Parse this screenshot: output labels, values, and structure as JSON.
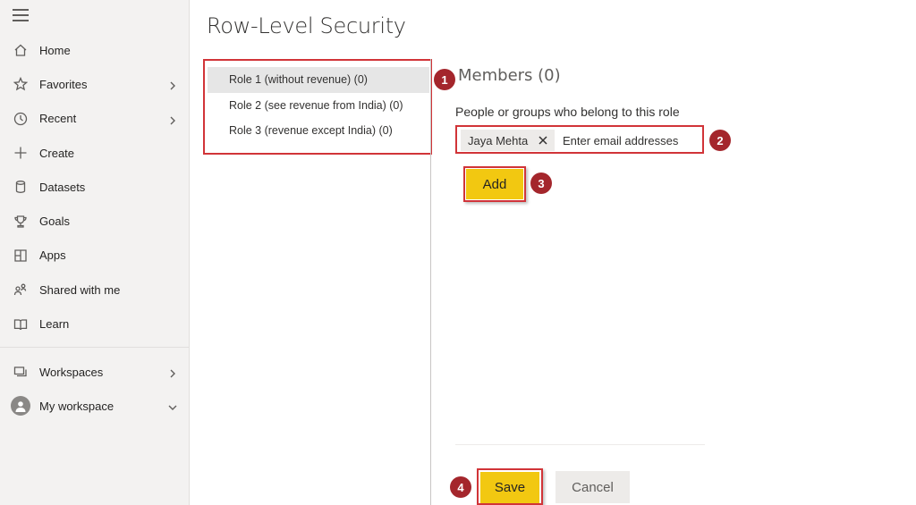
{
  "sidebar": {
    "items": [
      {
        "label": "Home",
        "icon": "home-icon"
      },
      {
        "label": "Favorites",
        "icon": "star-icon"
      },
      {
        "label": "Recent",
        "icon": "clock-icon"
      },
      {
        "label": "Create",
        "icon": "plus-icon"
      },
      {
        "label": "Datasets",
        "icon": "database-icon"
      },
      {
        "label": "Goals",
        "icon": "trophy-icon"
      },
      {
        "label": "Apps",
        "icon": "apps-icon"
      },
      {
        "label": "Shared with me",
        "icon": "shared-icon"
      },
      {
        "label": "Learn",
        "icon": "book-icon"
      }
    ],
    "bottom_items": [
      {
        "label": "Workspaces",
        "icon": "workspaces-icon"
      },
      {
        "label": "My workspace",
        "icon": "avatar-icon"
      }
    ]
  },
  "page": {
    "title": "Row-Level Security"
  },
  "roles": [
    {
      "label": "Role 1 (without revenue) (0)",
      "selected": true
    },
    {
      "label": "Role 2 (see revenue from India) (0)",
      "selected": false
    },
    {
      "label": "Role 3 (revenue except India) (0)",
      "selected": false
    }
  ],
  "members": {
    "title": "Members (0)",
    "label": "People or groups who belong to this role",
    "chip": "Jaya Mehta",
    "placeholder": "Enter email addresses",
    "add_label": "Add"
  },
  "footer": {
    "save_label": "Save",
    "cancel_label": "Cancel"
  },
  "badges": [
    "1",
    "2",
    "3",
    "4"
  ],
  "colors": {
    "accent_yellow": "#f2c811",
    "highlight_red": "#d13438",
    "badge_red": "#a4262c",
    "sidebar_bg": "#f3f2f1"
  }
}
